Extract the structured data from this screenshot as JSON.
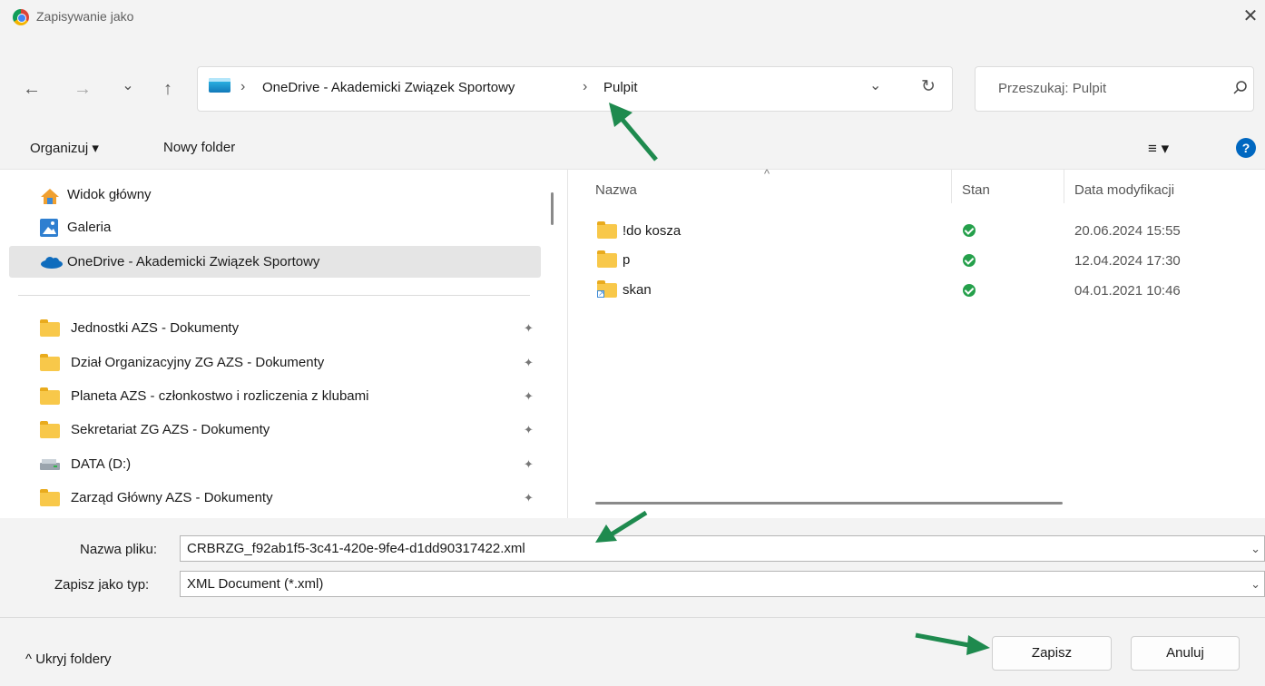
{
  "window": {
    "title": "Zapisywanie jako",
    "close_glyph": "✕",
    "app_icon": "chrome-icon"
  },
  "nav": {
    "back_glyph": "←",
    "forward_glyph": "→",
    "recent_glyph": "⌄",
    "up_glyph": "↑",
    "breadcrumb": [
      "OneDrive - Akademicki Związek Sportowy",
      "Pulpit"
    ],
    "crumb_sep": "›",
    "dropdown_glyph": "⌄",
    "refresh_glyph": "↻",
    "search_placeholder": "Przeszukaj: Pulpit"
  },
  "toolbar": {
    "organize_label": "Organizuj ▾",
    "new_folder_label": "Nowy folder",
    "view_glyph": "≡ ▾",
    "help_glyph": "?"
  },
  "sidebar": {
    "top_items": [
      {
        "label": "Widok główny",
        "icon": "home-icon"
      },
      {
        "label": "Galeria",
        "icon": "gallery-icon"
      },
      {
        "label": "OneDrive - Akademicki Związek Sportowy",
        "icon": "cloud-icon",
        "selected": true
      }
    ],
    "pinned_items": [
      {
        "label": "Jednostki AZS - Dokumenty",
        "icon": "folder-icon"
      },
      {
        "label": "Dział Organizacyjny ZG AZS - Dokumenty",
        "icon": "folder-icon"
      },
      {
        "label": "Planeta AZS - członkostwo i rozliczenia z klubami",
        "icon": "folder-icon"
      },
      {
        "label": "Sekretariat ZG AZS - Dokumenty",
        "icon": "folder-icon"
      },
      {
        "label": "DATA (D:)",
        "icon": "drive-icon"
      },
      {
        "label": "Zarząd Główny AZS - Dokumenty",
        "icon": "folder-icon"
      }
    ],
    "pin_glyph": "📌"
  },
  "files": {
    "columns": [
      "Nazwa",
      "Stan",
      "Data modyfikacji"
    ],
    "sort_glyph": "^",
    "rows": [
      {
        "name": "!do kosza",
        "status": "ok",
        "modified": "20.06.2024 15:55"
      },
      {
        "name": "p",
        "status": "ok",
        "modified": "12.04.2024 17:30"
      },
      {
        "name": "skan",
        "status": "ok",
        "modified": "04.01.2021 10:46"
      }
    ]
  },
  "form": {
    "filename_label": "Nazwa pliku:",
    "filename_value": "CRBRZG_f92ab1f5-3c41-420e-9fe4-d1dd90317422.xml",
    "type_label": "Zapisz jako typ:",
    "type_value": "XML Document (*.xml)",
    "chevron_glyph": "⌄"
  },
  "footer": {
    "hide_folders_label": "^  Ukryj foldery",
    "save_label": "Zapisz",
    "cancel_label": "Anuluj"
  },
  "colors": {
    "accent": "#0067c0",
    "annotation_arrow": "#1e8a4e",
    "ok_green": "#25a04b",
    "folder_yellow": "#f8c84a"
  }
}
